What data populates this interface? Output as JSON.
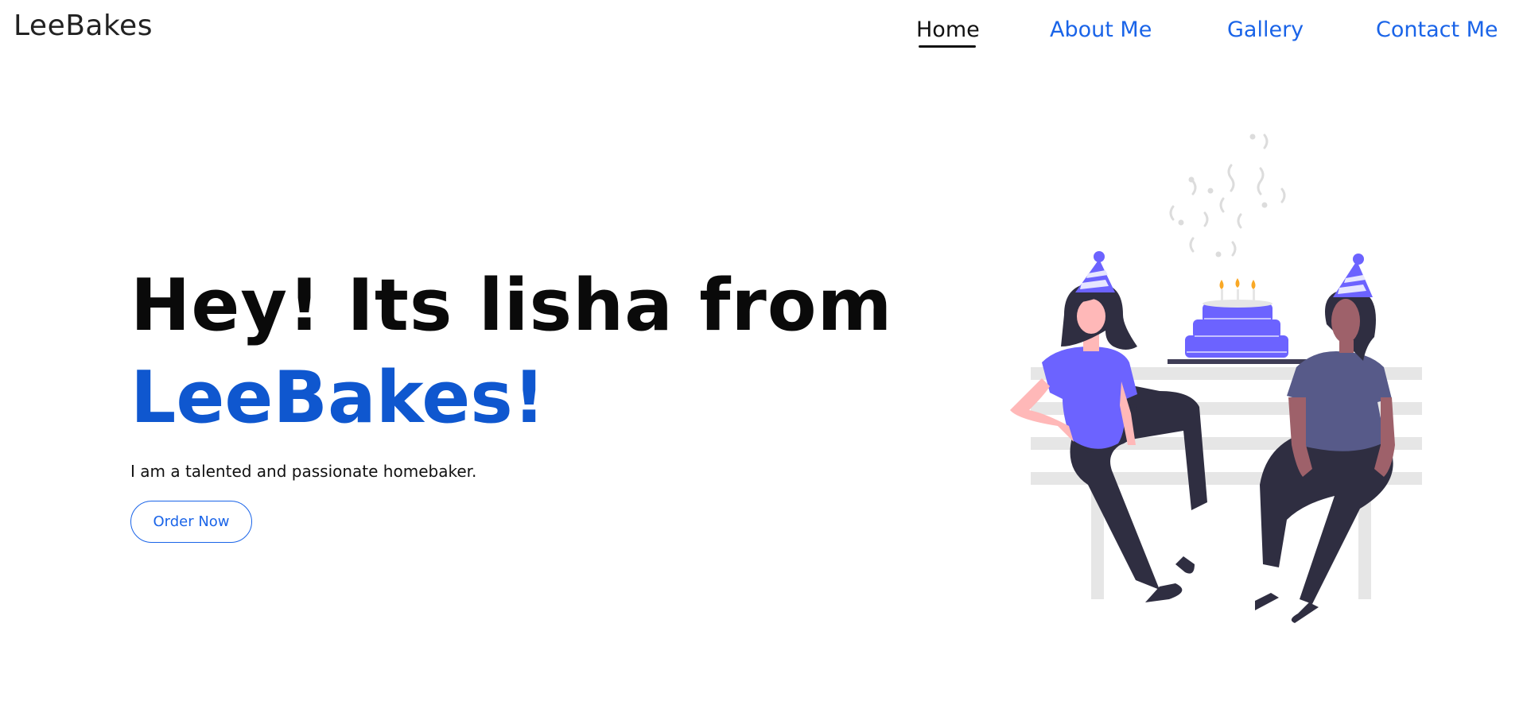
{
  "header": {
    "logo": "LeeBakes"
  },
  "nav": {
    "items": [
      {
        "label": "Home",
        "active": true
      },
      {
        "label": "About Me",
        "active": false
      },
      {
        "label": "Gallery",
        "active": false
      },
      {
        "label": "Contact Me",
        "active": false
      }
    ]
  },
  "hero": {
    "title": "Hey! Its lisha from",
    "brand": "LeeBakes!",
    "subtitle": "I am a talented and passionate homebaker.",
    "cta_label": "Order Now"
  },
  "colors": {
    "accent": "#1a64e8",
    "brand_heading": "#0f57cf",
    "illustration_purple": "#6c63ff"
  }
}
